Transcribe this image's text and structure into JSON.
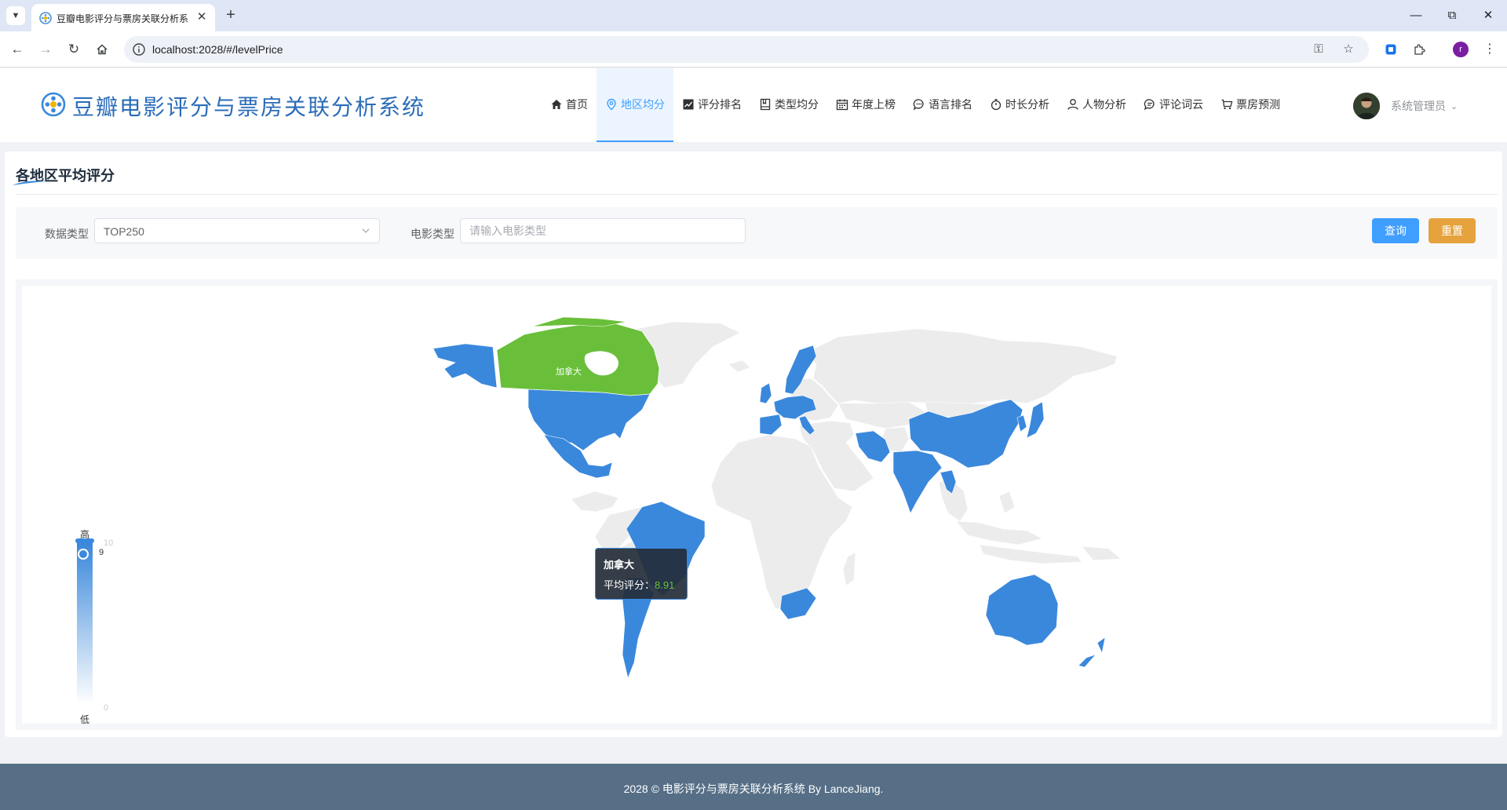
{
  "browser": {
    "tab_title": "豆瓣电影评分与票房关联分析系",
    "url": "localhost:2028/#/levelPrice",
    "profile_initial": "r"
  },
  "app": {
    "title": "豆瓣电影评分与票房关联分析系统",
    "menu": [
      {
        "label": "首页",
        "icon": "home-icon",
        "active": false
      },
      {
        "label": "地区均分",
        "icon": "location-icon",
        "active": true
      },
      {
        "label": "评分排名",
        "icon": "trend-chart-icon",
        "active": false
      },
      {
        "label": "类型均分",
        "icon": "notebook-icon",
        "active": false
      },
      {
        "label": "年度上榜",
        "icon": "calendar-icon",
        "active": false
      },
      {
        "label": "语言排名",
        "icon": "chat-icon",
        "active": false
      },
      {
        "label": "时长分析",
        "icon": "stopwatch-icon",
        "active": false
      },
      {
        "label": "人物分析",
        "icon": "user-icon",
        "active": false
      },
      {
        "label": "评论词云",
        "icon": "chat-dots-icon",
        "active": false
      },
      {
        "label": "票房预测",
        "icon": "cart-icon",
        "active": false
      }
    ],
    "user_name": "系统管理员"
  },
  "page": {
    "title": "各地区平均评分",
    "filters": {
      "data_type_label": "数据类型",
      "data_type_value": "TOP250",
      "movie_type_label": "电影类型",
      "movie_type_placeholder": "请输入电影类型",
      "query_button": "查询",
      "reset_button": "重置"
    }
  },
  "chart_data": {
    "type": "map",
    "map": "world",
    "visual_map": {
      "min": 0,
      "max": 10,
      "high_text": "高",
      "low_text": "低",
      "handle_value": "9",
      "max_label": "10",
      "min_label": "0"
    },
    "label": "加拿大",
    "highlighted_region": "加拿大",
    "colors": {
      "data_region": "#3a88dc",
      "highlight": "#6abf3a",
      "no_data": "#ececec"
    },
    "tooltip": {
      "name": "加拿大",
      "metric": "平均评分：",
      "value": "8.91"
    }
  },
  "footer": {
    "text": "2028 © 电影评分与票房关联分析系统 By LanceJiang."
  }
}
